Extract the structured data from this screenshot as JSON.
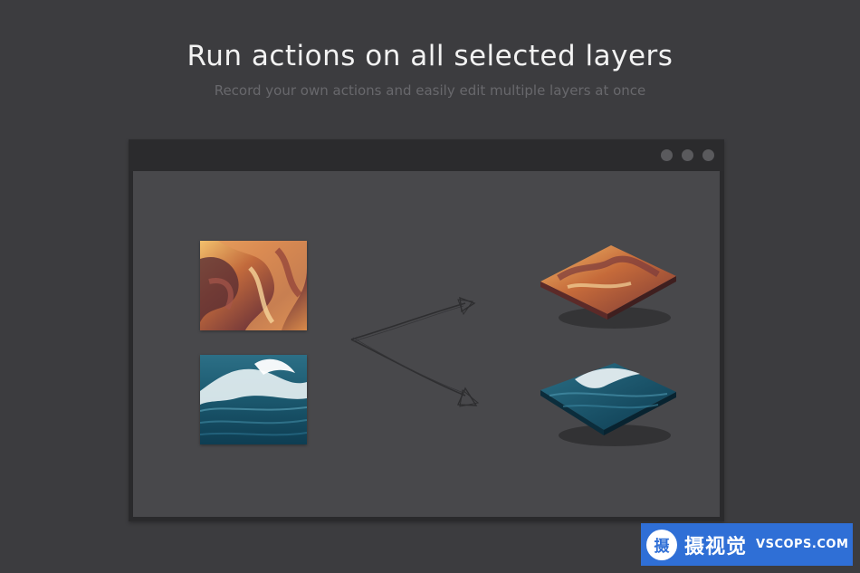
{
  "header": {
    "title": "Run actions on all selected layers",
    "subtitle": "Record your own actions and easily edit multiple layers at once"
  },
  "window": {
    "controls": [
      "window-dot",
      "window-dot",
      "window-dot"
    ]
  },
  "images": {
    "canyon": "canyon-photo",
    "wave": "wave-photo"
  },
  "watermark": {
    "logo_char": "摄",
    "cn_text": "摄视觉",
    "en_text": "VSCOPS.COM"
  },
  "colors": {
    "background": "#3c3c3f",
    "window_frame": "#2a2a2c",
    "canvas": "#48484b",
    "watermark": "#2f6fd6"
  }
}
